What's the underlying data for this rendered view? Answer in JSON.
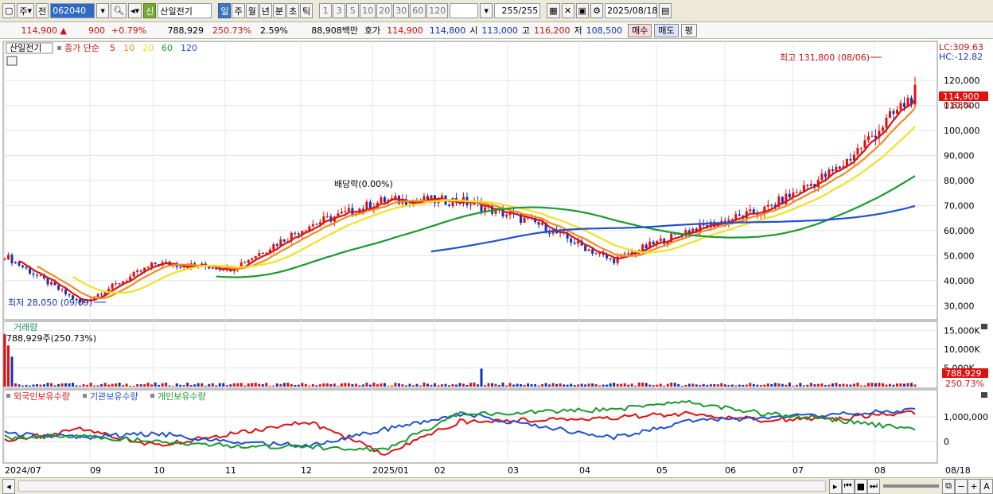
{
  "toolbar": {
    "market_type": "주",
    "market_scope": "전",
    "stock_code": "062040",
    "new_badge": "신",
    "stock_name": "산일전기",
    "periods": [
      "일",
      "주",
      "월",
      "년",
      "분",
      "초",
      "틱"
    ],
    "active_period": "일",
    "intervals": [
      "1",
      "3",
      "5",
      "10",
      "20",
      "30",
      "60",
      "120"
    ],
    "count_display": "255",
    "count_total": "/255",
    "date": "2025/08/18"
  },
  "quote": {
    "price": "114,900",
    "direction_symbol": "▲",
    "change": "900",
    "change_pct": "+0.79%",
    "volume": "788,929",
    "volume_ratio": "250.73%",
    "turnover": "2.59%",
    "trade_value": "88,908백만",
    "bid_label": "호가",
    "ask_price": "114,900",
    "bid_price": "114,800",
    "open_label": "시",
    "open": "113,000",
    "high_label": "고",
    "high": "116,200",
    "low_label": "저",
    "low": "108,500",
    "buy_button": "매수",
    "sell_button": "매도",
    "eval_button": "평"
  },
  "price_panel": {
    "stock_name": "산일전기",
    "ma_title": "종가 단순",
    "ma_periods": [
      "5",
      "10",
      "20",
      "60",
      "120"
    ],
    "ma_colors": [
      "#e01010",
      "#f08c20",
      "#f4e020",
      "#1a9a30",
      "#2050d0"
    ],
    "lc": "LC:309.63",
    "hc": "HC:-12.82",
    "high_annotation": "최고 131,800 (08/06)",
    "low_annotation": "최저 28,050 (09/09)",
    "dividend_annotation": "배당락(0.00%)",
    "current_price_tag": "114,900",
    "current_change_tag": "0.88%",
    "y_ticks": [
      "120,000",
      "110,000",
      "100,000",
      "90,000",
      "80,000",
      "70,000",
      "60,000",
      "50,000",
      "40,000",
      "30,000"
    ]
  },
  "volume_panel": {
    "title": "거래량",
    "current": "788,929주(250.73%)",
    "y_ticks": [
      "15,000K",
      "10,000K",
      "5,000K"
    ],
    "value_tag": "788,929",
    "pct_tag": "250.73%"
  },
  "holdings_panel": {
    "legends": [
      "외국인보유수량",
      "기관보유수량",
      "개인보유수량"
    ],
    "colors": [
      "#e01010",
      "#2050d0",
      "#1a9a30"
    ],
    "y_ticks": [
      "1,000,000",
      "0"
    ]
  },
  "x_axis": {
    "labels": [
      "2024/07",
      "09",
      "10",
      "11",
      "12",
      "2025/01",
      "02",
      "03",
      "04",
      "05",
      "06",
      "07",
      "08"
    ],
    "last_label": "08/18"
  },
  "chart_data": {
    "type": "candlestick",
    "x": [
      "2024/07",
      "2024/09",
      "2024/10",
      "2024/11",
      "2024/12",
      "2025/01",
      "2025/02",
      "2025/03",
      "2025/04",
      "2025/05",
      "2025/06",
      "2025/07",
      "2025/08"
    ],
    "close_approx": [
      50000,
      31000,
      47000,
      45000,
      62000,
      72000,
      72000,
      63000,
      48000,
      60000,
      68000,
      85000,
      114900
    ],
    "ylim": [
      25000,
      135000
    ],
    "series": [
      {
        "name": "5",
        "type": "line"
      },
      {
        "name": "10",
        "type": "line"
      },
      {
        "name": "20",
        "type": "line"
      },
      {
        "name": "60",
        "type": "line"
      },
      {
        "name": "120",
        "type": "line"
      }
    ]
  }
}
